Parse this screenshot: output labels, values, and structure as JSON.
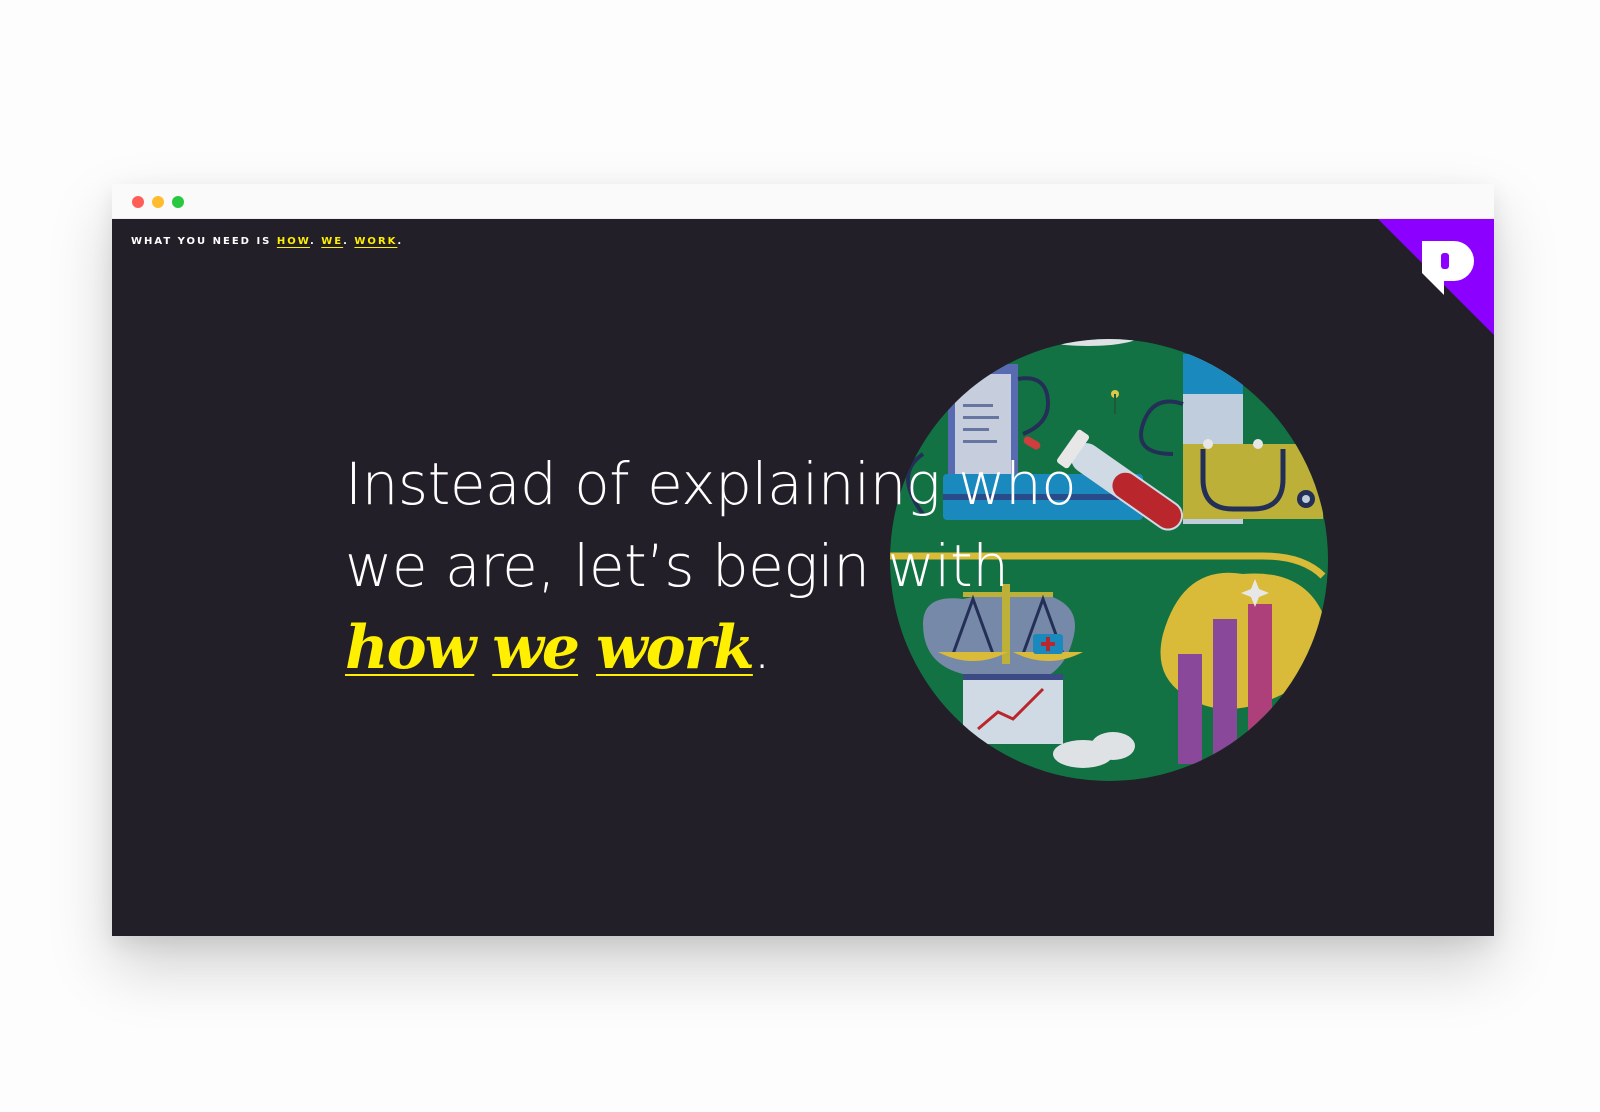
{
  "window": {
    "controls": [
      "close",
      "minimize",
      "maximize"
    ]
  },
  "header": {
    "tagline_prefix": "WHAT YOU NEED IS ",
    "links": [
      "HOW",
      "WE",
      "WORK"
    ],
    "separator": ". ",
    "end": "."
  },
  "logo": {
    "letter": "P",
    "accent_color": "#8b00ff"
  },
  "hero": {
    "line1": "Instead of explaining who",
    "line2": "we are, let’s begin with",
    "emphasis": [
      "how",
      "we",
      "work"
    ],
    "end": "."
  },
  "illustration": {
    "icons": [
      "clipboard-icon",
      "test-tube-icon",
      "stethoscope-icon",
      "scales-icon",
      "medical-kit-icon",
      "line-chart-icon",
      "bar-chart-icon",
      "cloud-icon",
      "pill-icon"
    ]
  },
  "colors": {
    "background": "#221f29",
    "accent": "#ffef00",
    "brand": "#8b00ff",
    "illustration_green": "#127746"
  }
}
